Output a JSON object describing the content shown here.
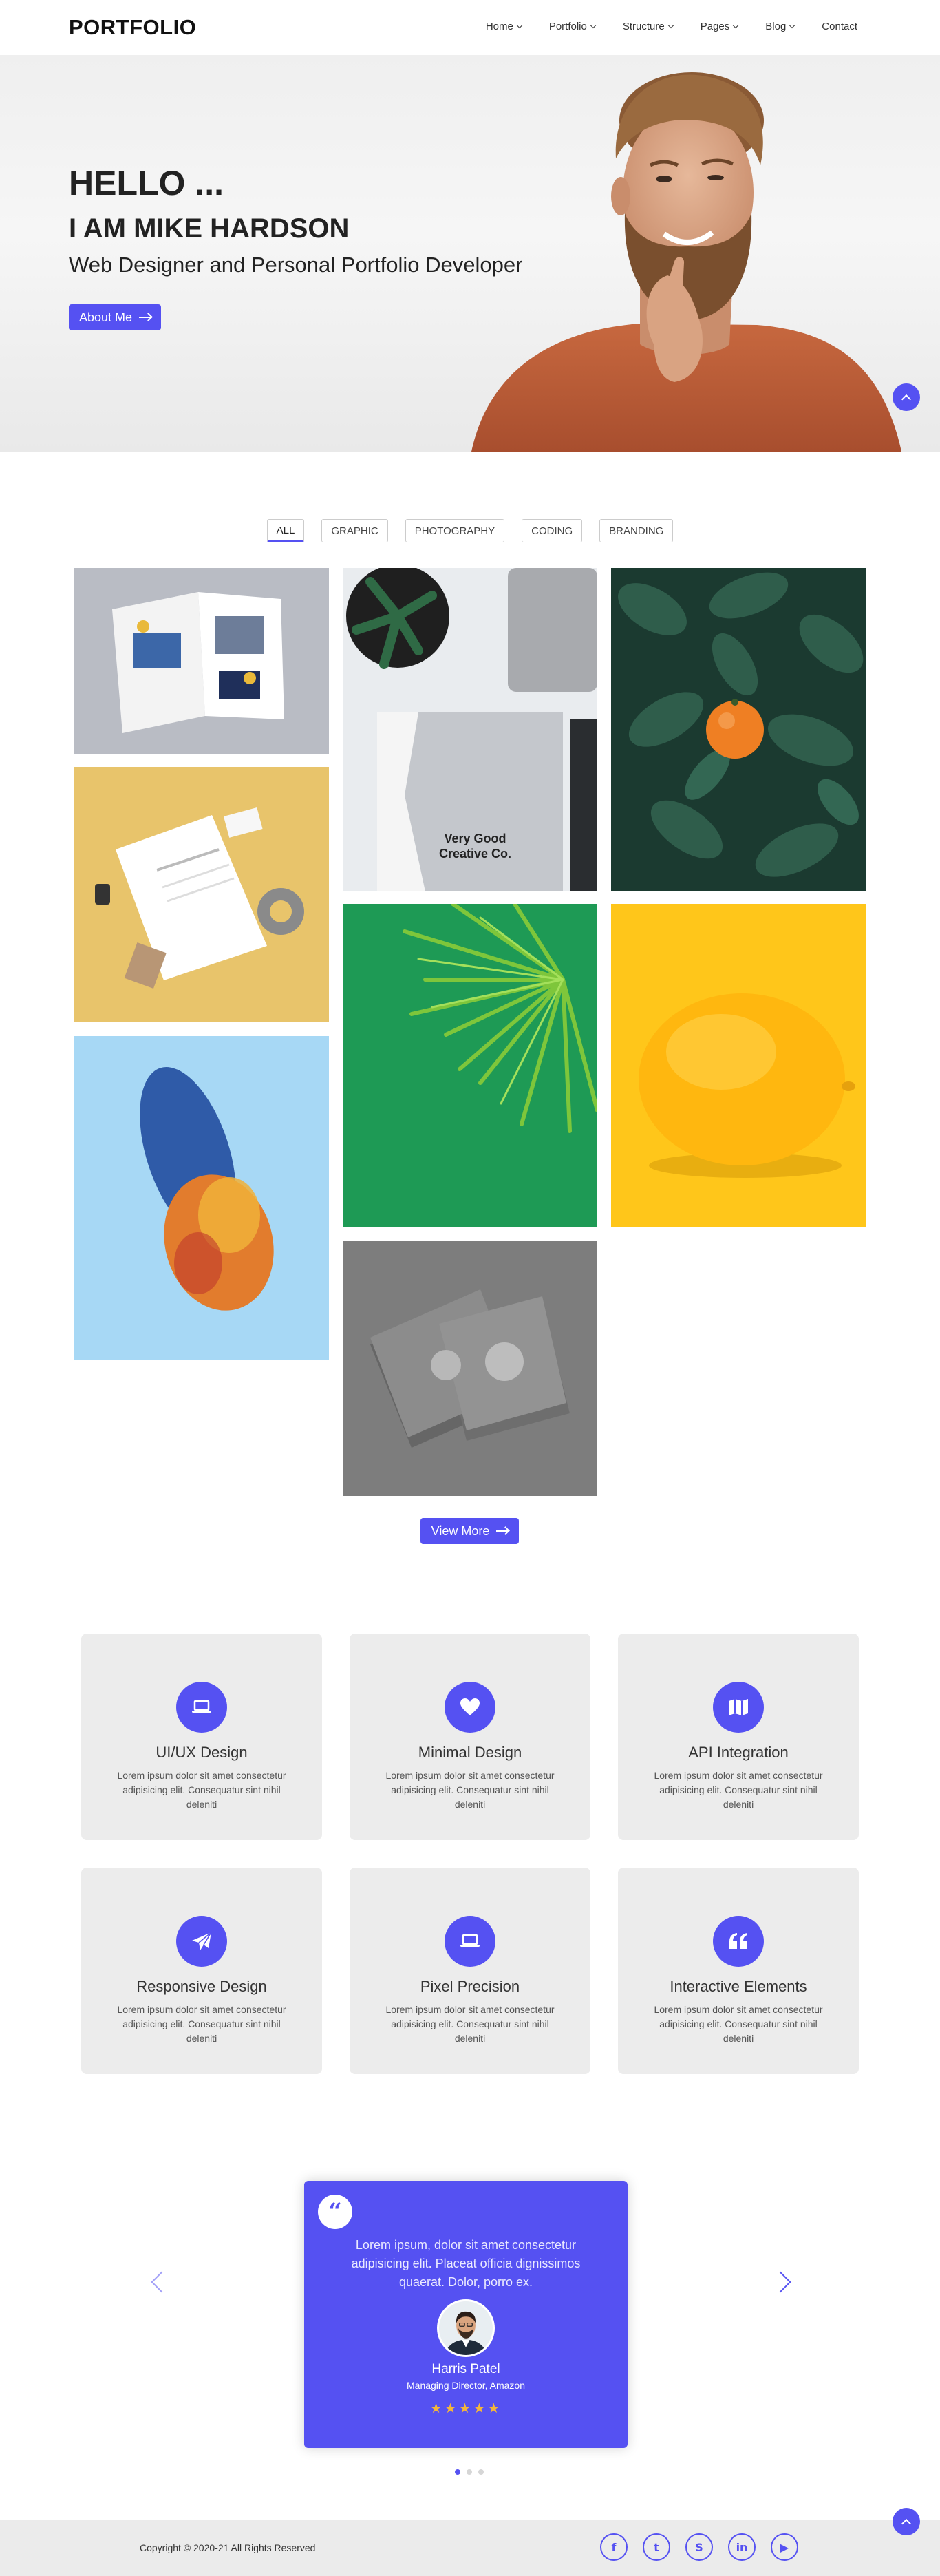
{
  "nav": {
    "logo": "PORTFOLIO",
    "items": [
      {
        "label": "Home",
        "dropdown": true
      },
      {
        "label": "Portfolio",
        "dropdown": true
      },
      {
        "label": "Structure",
        "dropdown": true
      },
      {
        "label": "Pages",
        "dropdown": true
      },
      {
        "label": "Blog",
        "dropdown": true
      },
      {
        "label": "Contact",
        "dropdown": false
      }
    ]
  },
  "hero": {
    "greeting": "HELLO ...",
    "name": "I AM MIKE HARDSON",
    "role": "Web Designer and Personal Portfolio Developer",
    "button": "About Me"
  },
  "filters": [
    {
      "label": "ALL",
      "active": true
    },
    {
      "label": "GRAPHIC",
      "active": false
    },
    {
      "label": "PHOTOGRAPHY",
      "active": false
    },
    {
      "label": "CODING",
      "active": false
    },
    {
      "label": "BRANDING",
      "active": false
    }
  ],
  "gallery": {
    "notebook_text": "Very Good\nCreative Co.",
    "view_more": "View More"
  },
  "services": [
    {
      "icon": "laptop-icon",
      "title": "UI/UX Design",
      "text": "Lorem ipsum dolor sit amet consectetur adipisicing elit. Consequatur sint nihil deleniti"
    },
    {
      "icon": "heart-icon",
      "title": "Minimal Design",
      "text": "Lorem ipsum dolor sit amet consectetur adipisicing elit. Consequatur sint nihil deleniti"
    },
    {
      "icon": "map-icon",
      "title": "API Integration",
      "text": "Lorem ipsum dolor sit amet consectetur adipisicing elit. Consequatur sint nihil deleniti"
    },
    {
      "icon": "paper-plane-icon",
      "title": "Responsive Design",
      "text": "Lorem ipsum dolor sit amet consectetur adipisicing elit. Consequatur sint nihil deleniti"
    },
    {
      "icon": "laptop-icon",
      "title": "Pixel Precision",
      "text": "Lorem ipsum dolor sit amet consectetur adipisicing elit. Consequatur sint nihil deleniti"
    },
    {
      "icon": "quote-icon",
      "title": "Interactive Elements",
      "text": "Lorem ipsum dolor sit amet consectetur adipisicing elit. Consequatur sint nihil deleniti"
    }
  ],
  "testimonial": {
    "quote_glyph": "“",
    "text": "Lorem ipsum, dolor sit amet consectetur adipisicing elit. Placeat officia dignissimos quaerat. Dolor, porro ex.",
    "name": "Harris Patel",
    "role": "Managing Director, Amazon",
    "rating": 5,
    "stars": "★★★★★",
    "slide_count": 3,
    "active_slide": 0
  },
  "footer": {
    "copyright": "Copyright © 2020-21 All Rights Reserved",
    "socials": [
      {
        "name": "facebook-icon",
        "glyph": "f"
      },
      {
        "name": "twitter-icon",
        "glyph": "t"
      },
      {
        "name": "skype-icon",
        "glyph": "S"
      },
      {
        "name": "linkedin-icon",
        "glyph": "in"
      },
      {
        "name": "youtube-icon",
        "glyph": "▶"
      }
    ]
  },
  "colors": {
    "accent": "#5551f2",
    "star": "#f4b63a"
  }
}
